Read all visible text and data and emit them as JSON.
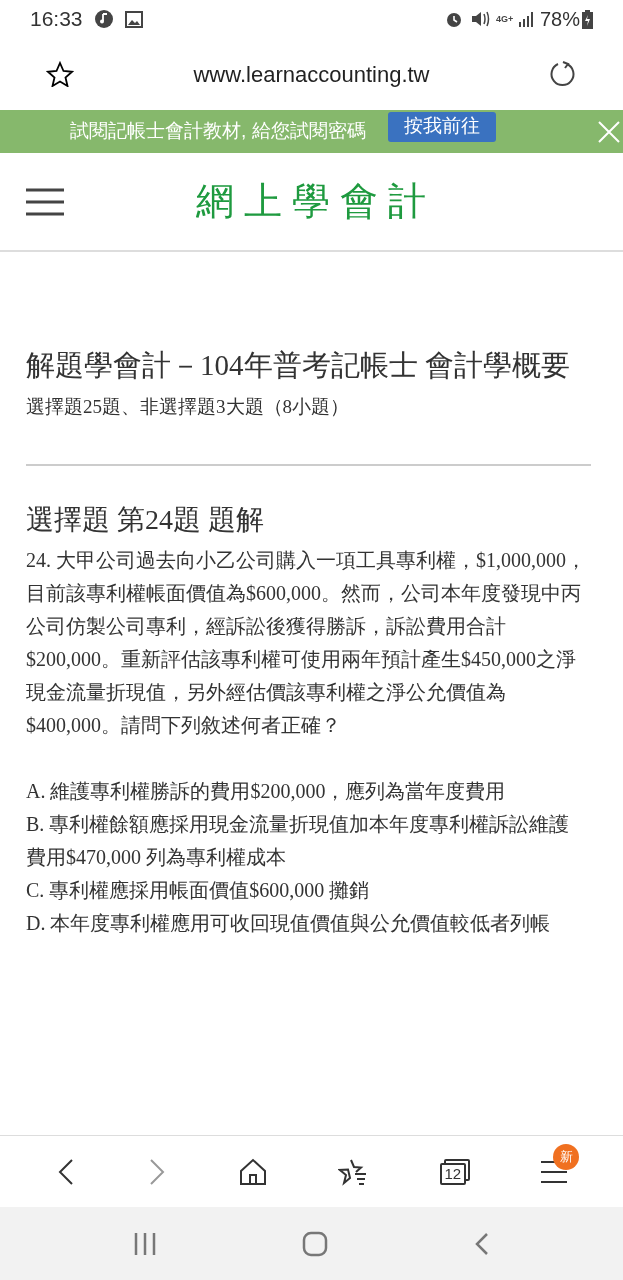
{
  "status_bar": {
    "time": "16:33",
    "network": "4G+",
    "battery": "78%"
  },
  "browser": {
    "url": "www.learnaccounting.tw"
  },
  "banner": {
    "text": "試閱記帳士會計教材, 給您試閱密碼",
    "button": "按我前往"
  },
  "site_header": {
    "logo": "網上學會計"
  },
  "article": {
    "title": "解題學會計－104年普考記帳士 會計學概要",
    "subtitle": "選擇題25題、非選擇題3大題（8小題）",
    "section_heading": "選擇題 第24題 題解",
    "question": "24. 大甲公司過去向小乙公司購入一項工具專利權，$1,000,000，目前該專利權帳面價值為$600,000。然而，公司本年度發現中丙公司仿製公司專利，經訴訟後獲得勝訴，訴訟費用合計$200,000。重新評估該專利權可使用兩年預計產生$450,000之淨現金流量折現值，另外經估價該專利權之淨公允價值為$400,000。請問下列敘述何者正確？",
    "options": [
      "A. 維護專利權勝訴的費用$200,000，應列為當年度費用",
      "B. 專利權餘額應採用現金流量折現值加本年度專利權訴訟維護費用$470,000 列為專利權成本",
      "C. 專利權應採用帳面價值$600,000 攤銷",
      "D. 本年度專利權應用可收回現值價值與公允價值較低者列帳"
    ]
  },
  "toolbar": {
    "tab_count": "12",
    "menu_badge": "新"
  }
}
